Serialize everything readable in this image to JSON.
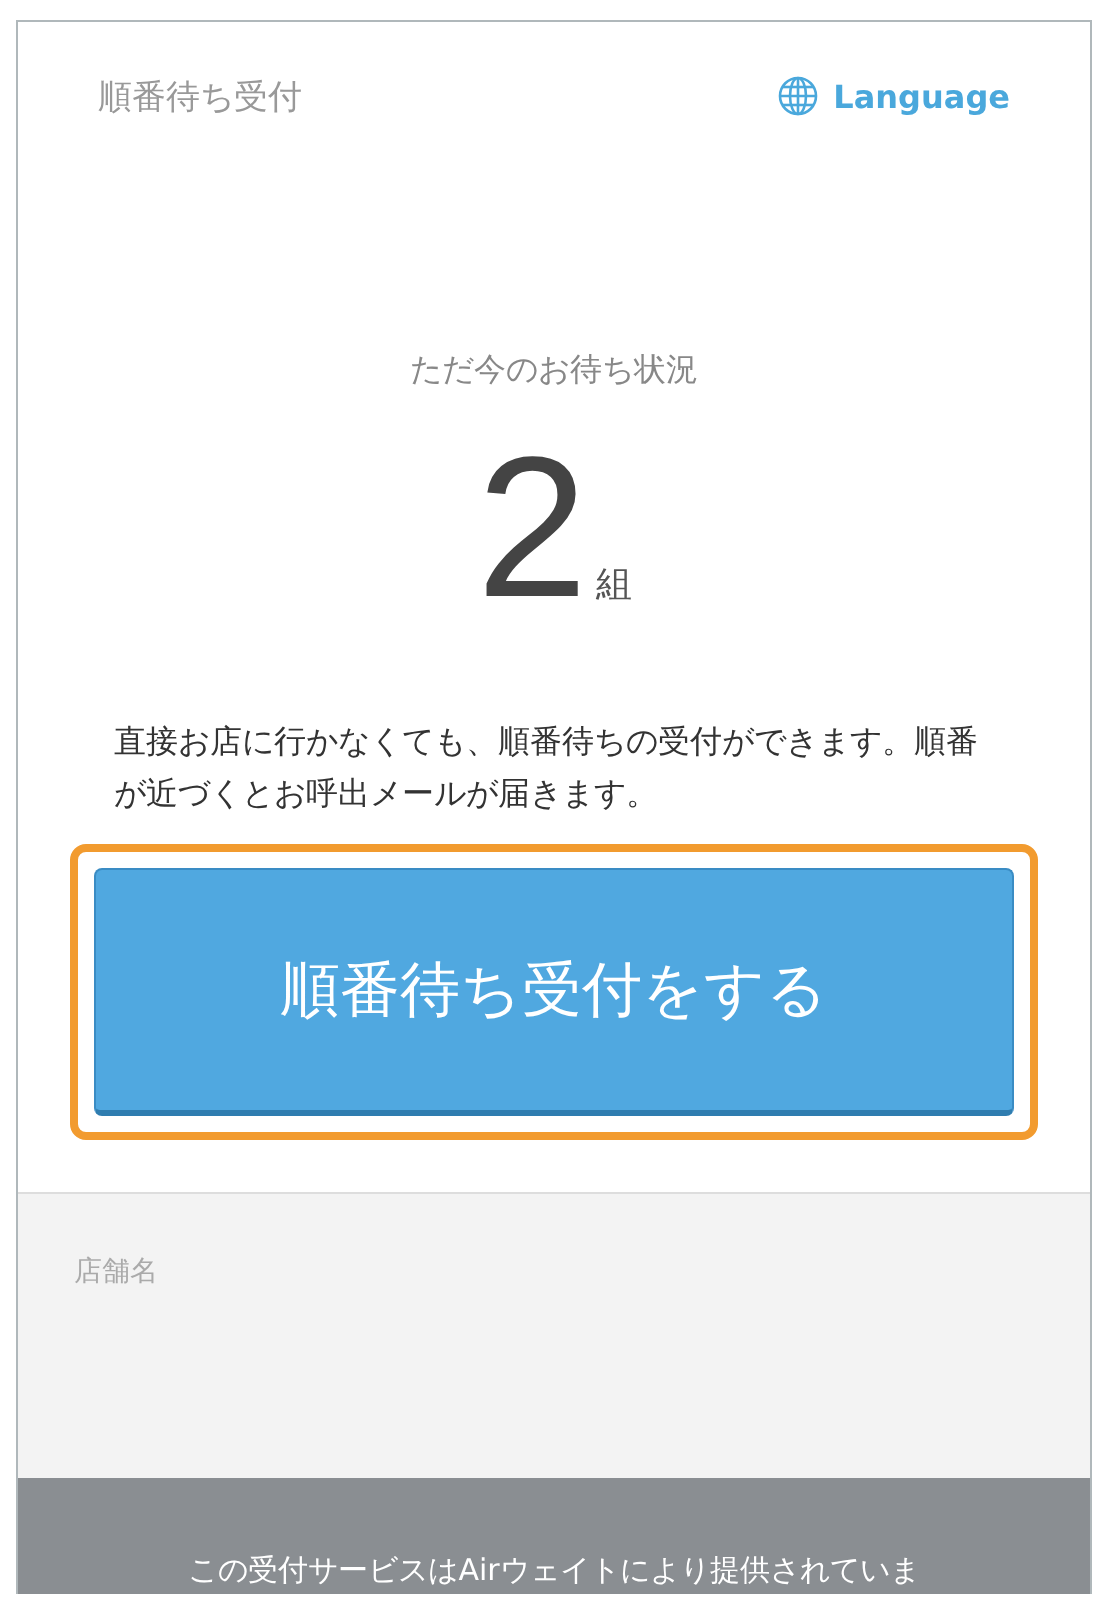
{
  "header": {
    "title": "順番待ち受付",
    "language_link": "Language"
  },
  "status": {
    "label": "ただ今のお待ち状況",
    "count": "2",
    "unit": "組"
  },
  "description": "直接お店に行かなくても、順番待ちの受付ができます。順番が近づくとお呼出メールが届きます。",
  "primary_button": {
    "label": "順番待ち受付をする",
    "highlighted": true
  },
  "store": {
    "label": "店舗名"
  },
  "footer": {
    "text": "この受付サービスはAirウェイトにより提供されていま"
  }
}
